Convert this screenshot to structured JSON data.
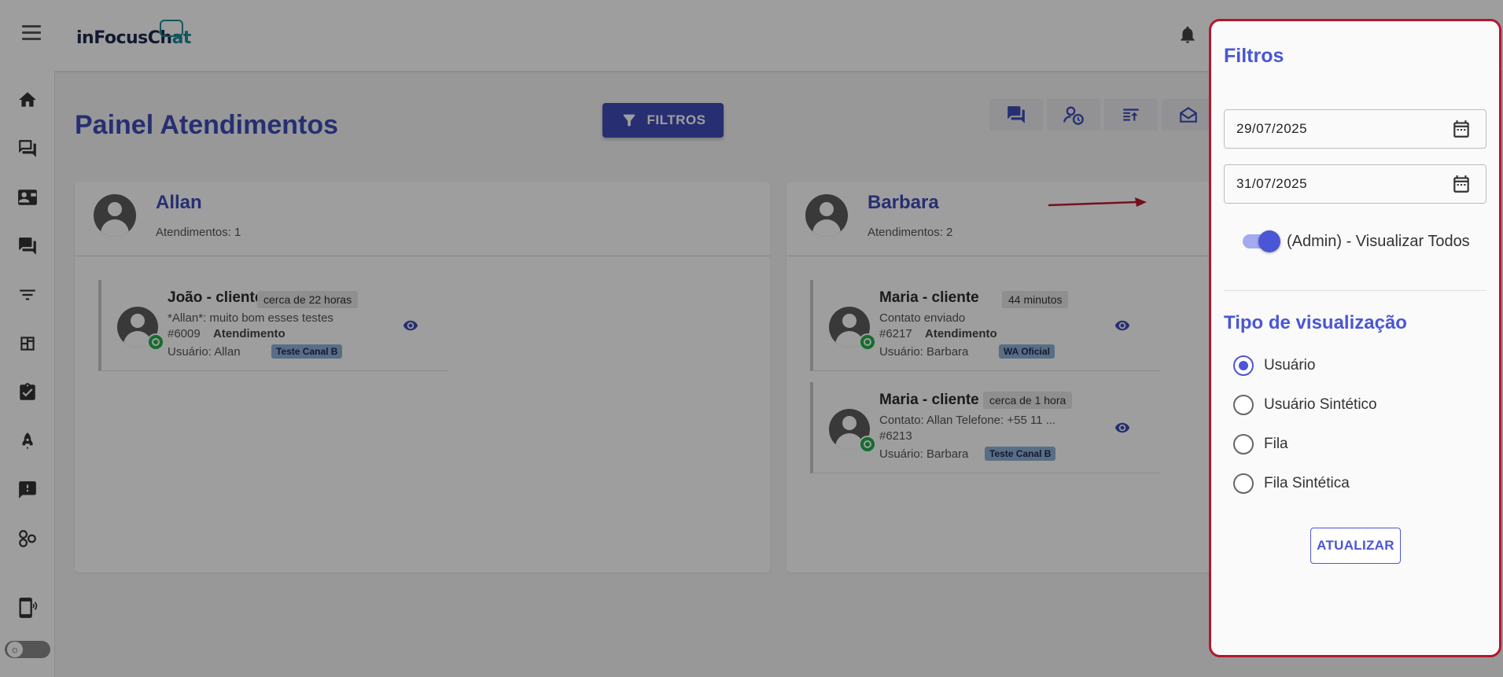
{
  "header": {
    "logo_main": "inFocusCh",
    "logo_accent": "at",
    "menu_icon": "hamburger-menu-icon",
    "bell_icon": "bell-icon"
  },
  "sidebar": {
    "items": [
      {
        "name": "home",
        "icon": "home-icon"
      },
      {
        "name": "chats",
        "icon": "chat-bubbles-icon"
      },
      {
        "name": "contacts",
        "icon": "contact-card-icon"
      },
      {
        "name": "messages",
        "icon": "message-icon"
      },
      {
        "name": "filters",
        "icon": "filter-lines-icon"
      },
      {
        "name": "dashboard",
        "icon": "dashboard-icon"
      },
      {
        "name": "reports",
        "icon": "clipboard-icon"
      },
      {
        "name": "campaigns",
        "icon": "rocket-icon"
      },
      {
        "name": "feedback",
        "icon": "feedback-icon"
      },
      {
        "name": "integrations",
        "icon": "nodes-icon"
      },
      {
        "name": "channels",
        "icon": "phone-broadcast-icon"
      }
    ],
    "theme_toggle_icon": "sun-icon"
  },
  "main": {
    "title": "Painel Atendimentos",
    "filter_button": "FILTROS",
    "toolbar_icons": [
      "chat-icon",
      "user-clock-icon",
      "queue-sort-icon",
      "envelope-open-icon"
    ]
  },
  "columns": [
    {
      "name": "Allan",
      "count_label": "Atendimentos: 1",
      "tickets": [
        {
          "name": "João - cliente",
          "time": "cerca de 22 horas",
          "last_message": "*Allan*: muito bom esses testes",
          "id": "#6009",
          "status": "Atendimento",
          "user": "Usuário: Allan",
          "tag": "Teste Canal B"
        }
      ]
    },
    {
      "name": "Barbara",
      "count_label": "Atendimentos: 2",
      "tickets": [
        {
          "name": "Maria - cliente",
          "time": "44 minutos",
          "last_message": "Contato enviado",
          "id": "#6217",
          "status": "Atendimento",
          "user": "Usuário: Barbara",
          "tag": "WA Oficial"
        },
        {
          "name": "Maria - cliente",
          "time": "cerca de 1 hora",
          "last_message": "Contato: Allan Telefone: +55 11 ...",
          "id": "#6213",
          "status": "",
          "user": "Usuário: Barbara",
          "tag": "Teste Canal B"
        }
      ]
    }
  ],
  "drawer": {
    "title": "Filtros",
    "date_start": "29/07/2025",
    "date_end": "31/07/2025",
    "switch_label": "(Admin) - Visualizar Todos",
    "switch_on": true,
    "view_title": "Tipo de visualização",
    "view_options": [
      {
        "label": "Usuário",
        "checked": true
      },
      {
        "label": "Usuário Sintético",
        "checked": false
      },
      {
        "label": "Fila",
        "checked": false
      },
      {
        "label": "Fila Sintética",
        "checked": false
      }
    ],
    "update_button": "ATUALIZAR"
  },
  "colors": {
    "primary": "#3f4db8",
    "drawer_accent": "#4a56d6",
    "highlight_border": "#b0182e",
    "whatsapp": "#22b04b",
    "tag_bg": "#8fb2d6"
  }
}
